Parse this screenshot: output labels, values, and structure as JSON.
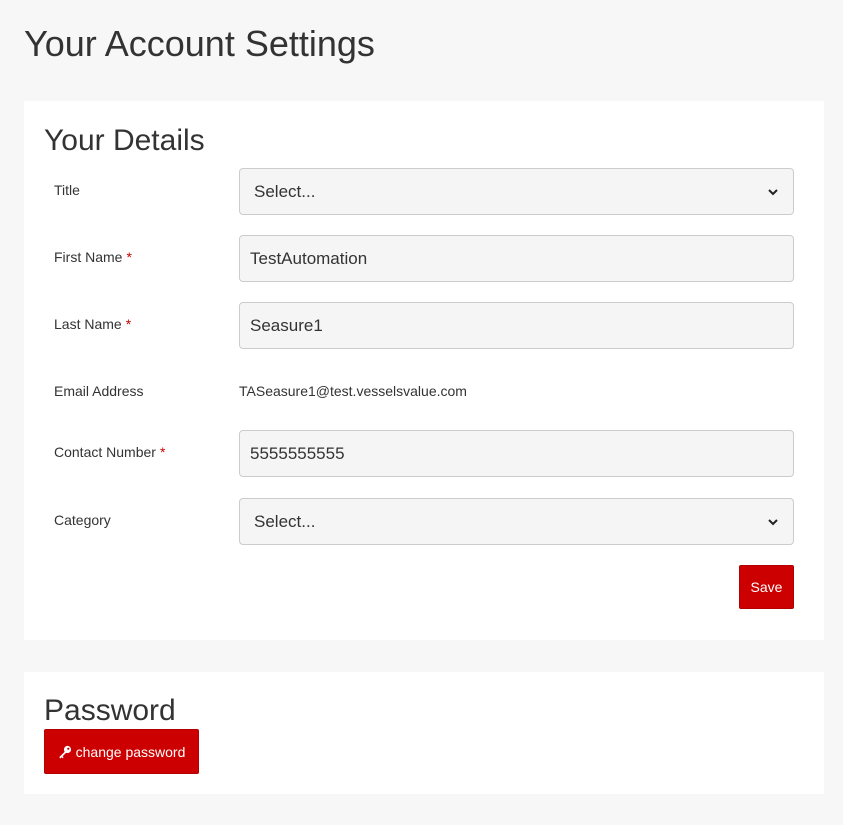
{
  "page": {
    "title": "Your Account Settings"
  },
  "details": {
    "heading": "Your Details",
    "required_mark": "*",
    "title": {
      "label": "Title",
      "selected": "Select..."
    },
    "first_name": {
      "label": "First Name",
      "value": "TestAutomation"
    },
    "last_name": {
      "label": "Last Name",
      "value": "Seasure1"
    },
    "email": {
      "label": "Email Address",
      "value": "TASeasure1@test.vesselsvalue.com"
    },
    "contact": {
      "label": "Contact Number",
      "value": "5555555555"
    },
    "category": {
      "label": "Category",
      "selected": "Select..."
    },
    "save_label": "Save"
  },
  "password": {
    "heading": "Password",
    "change_label": "change password"
  },
  "colors": {
    "accent": "#cc0000",
    "background": "#f7f7f7",
    "card": "#ffffff",
    "input_bg": "#f5f5f5"
  },
  "icons": {
    "password_button": "key-icon",
    "select_arrow": "chevron-down-icon"
  }
}
